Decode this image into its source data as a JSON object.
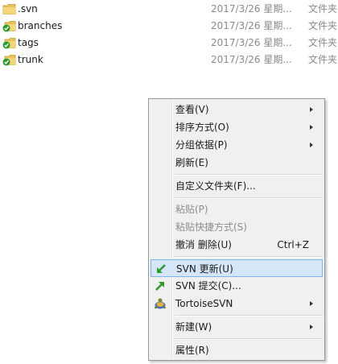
{
  "files": [
    {
      "name": ".svn",
      "date": "2017/3/26 星期...",
      "type": "文件夹",
      "icon": "folder-icon"
    },
    {
      "name": "branches",
      "date": "2017/3/26 星期...",
      "type": "文件夹",
      "icon": "svn-folder-ok-icon"
    },
    {
      "name": "tags",
      "date": "2017/3/26 星期...",
      "type": "文件夹",
      "icon": "svn-folder-ok-icon"
    },
    {
      "name": "trunk",
      "date": "2017/3/26 星期...",
      "type": "文件夹",
      "icon": "svn-folder-ok-icon"
    }
  ],
  "context_menu": {
    "view": "查看(V)",
    "sort_by": "排序方式(O)",
    "group_by": "分组依据(P)",
    "refresh": "刷新(E)",
    "customize_folder": "自定义文件夹(F)...",
    "paste": "粘贴(P)",
    "paste_shortcut": "粘贴快捷方式(S)",
    "undo_delete": "撤消 删除(U)",
    "undo_delete_shortcut": "Ctrl+Z",
    "svn_update": "SVN 更新(U)",
    "svn_commit": "SVN 提交(C)...",
    "tortoisesvn": "TortoiseSVN",
    "new": "新建(W)",
    "properties": "属性(R)"
  },
  "colors": {
    "folder": "#e8c25a",
    "svn_ok": "#2e9a2e",
    "highlight_bg": "#d5e6f8",
    "highlight_border": "#7eb4ea"
  }
}
